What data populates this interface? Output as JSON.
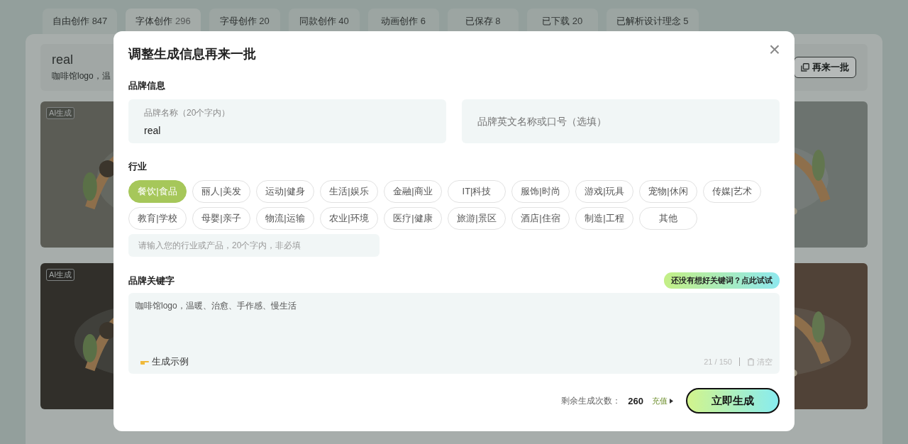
{
  "tabs": [
    {
      "label": "自由创作",
      "count": "847",
      "selected": false
    },
    {
      "label": "字体创作",
      "count": "296",
      "selected": true
    },
    {
      "label": "字母创作",
      "count": "20",
      "selected": false
    },
    {
      "label": "同款创作",
      "count": "40",
      "selected": false
    },
    {
      "label": "动画创作",
      "count": "6",
      "selected": false
    },
    {
      "label": "已保存",
      "count": "8",
      "selected": false
    },
    {
      "label": "已下载",
      "count": "20",
      "selected": false
    },
    {
      "label": "已解析设计理念",
      "count": "5",
      "selected": false
    }
  ],
  "batch": {
    "title": "real",
    "subtitle": "咖啡馆logo，温",
    "button": "再来一批"
  },
  "cards": [
    {
      "kind": "picture",
      "badge": "AI生成"
    },
    {
      "kind": "picture"
    },
    {
      "kind": "picture",
      "badge": "AI生成"
    },
    {
      "kind": "picture"
    }
  ],
  "dialog": {
    "title": "调整生成信息再来一批",
    "close": "×",
    "brand_info": {
      "label": "品牌信息",
      "name_label": "品牌名称（20个字内）",
      "name_value": "real",
      "slogan_placeholder": "品牌英文名称或口号（选填）"
    },
    "industry": {
      "label": "行业",
      "options": [
        {
          "label": "餐饮|食品",
          "selected": true
        },
        {
          "label": "丽人|美发",
          "selected": false
        },
        {
          "label": "运动|健身",
          "selected": false
        },
        {
          "label": "生活|娱乐",
          "selected": false
        },
        {
          "label": "金融|商业",
          "selected": false
        },
        {
          "label": "IT|科技",
          "selected": false
        },
        {
          "label": "服饰|时尚",
          "selected": false
        },
        {
          "label": "游戏|玩具",
          "selected": false
        },
        {
          "label": "宠物|休闲",
          "selected": false
        },
        {
          "label": "传媒|艺术",
          "selected": false
        },
        {
          "label": "教育|学校",
          "selected": false
        },
        {
          "label": "母婴|亲子",
          "selected": false
        },
        {
          "label": "物流|运输",
          "selected": false
        },
        {
          "label": "农业|环境",
          "selected": false
        },
        {
          "label": "医疗|健康",
          "selected": false
        },
        {
          "label": "旅游|景区",
          "selected": false
        },
        {
          "label": "酒店|住宿",
          "selected": false
        },
        {
          "label": "制造|工程",
          "selected": false
        },
        {
          "label": "其他",
          "selected": false
        }
      ],
      "other_placeholder": "请输入您的行业或产品，20个字内，非必填"
    },
    "keywords": {
      "label": "品牌关键字",
      "hint_button": "还没有想好关键词？点此试试",
      "value": "咖啡馆logo，温暖、治愈、手作感、慢生活",
      "example": "生成示例",
      "counter": "21 / 150",
      "clear": "清空"
    },
    "footer": {
      "remaining_label": "剩余生成次数：",
      "remaining": "260",
      "recharge": "充值",
      "submit": "立即生成"
    }
  }
}
